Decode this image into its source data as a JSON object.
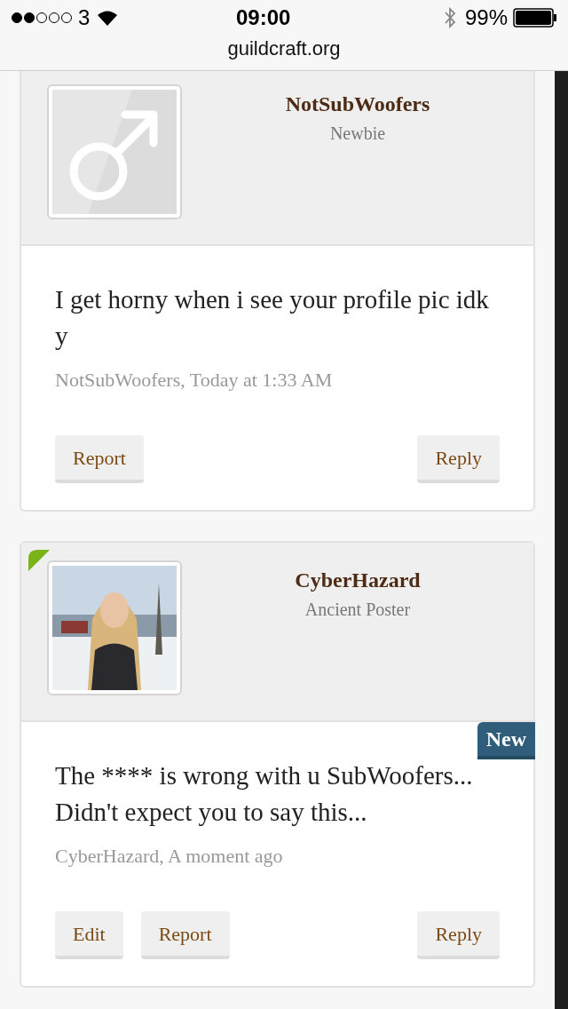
{
  "status_bar": {
    "carrier": "3",
    "time": "09:00",
    "battery": "99%"
  },
  "address_bar": {
    "url": "guildcraft.org"
  },
  "posts": [
    {
      "author": "NotSubWoofers",
      "title": "Newbie",
      "avatar": {
        "kind": "symbol"
      },
      "marked": false,
      "message": "I get horny when i see your profile pic idk y",
      "meta": "NotSubWoofers, Today at 1:33 AM",
      "left_actions": [
        "Report"
      ],
      "right_actions": [
        "Reply"
      ]
    },
    {
      "author": "CyberHazard",
      "title": "Ancient Poster",
      "avatar": {
        "kind": "picture"
      },
      "marked": true,
      "badge": "New",
      "message": "The **** is wrong with u SubWoofers... Didn't expect you to say this...",
      "meta": "CyberHazard, A moment ago",
      "left_actions": [
        "Edit",
        "Report"
      ],
      "right_actions": [
        "Reply"
      ]
    }
  ]
}
